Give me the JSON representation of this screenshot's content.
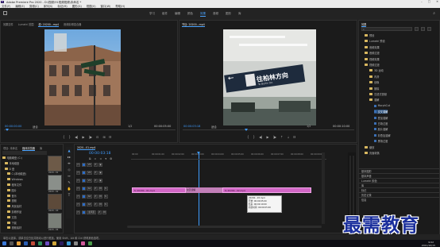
{
  "window": {
    "title": "Adobe Premiere Pro 2020 - D:\\视频\\91视频视频\\未命名 *",
    "controls": [
      "–",
      "□",
      "✕"
    ]
  },
  "menu": [
    "文件(F)",
    "编辑(E)",
    "剪辑(C)",
    "序列(S)",
    "标记(M)",
    "图形(G)",
    "视图(V)",
    "窗口(W)",
    "帮助(H)"
  ],
  "workspaces": {
    "tabs": [
      "学习",
      "组件",
      "编辑",
      "颜色",
      "效果",
      "音频",
      "图形",
      "库"
    ],
    "active": "效果"
  },
  "source_monitor": {
    "tabs": [
      "效果控件",
      "Lumetri 范围",
      "源: 20200...mp4",
      "音频剪辑混合器"
    ],
    "clip_label": "源: 20200...mp4",
    "timecode_left": "00:00:00:00",
    "fit": "适合",
    "ratio": "1/2",
    "timecode_right": "00:00:05:00",
    "marker": "■"
  },
  "program_monitor": {
    "tabs": [
      "节目: 20200...mp4"
    ],
    "clip_label": "节目: 20200...mp4",
    "timecode_left": "00:00:03:18",
    "fit": "适合",
    "ratio": "1/2",
    "timecode_right": "00:00:10:00",
    "sign": {
      "arrow": "←",
      "text": "往柏林方向",
      "sub": "To Berlin Str."
    }
  },
  "project_panel": {
    "tabs": [
      "项目: 未命名",
      "媒体浏览器",
      "库"
    ],
    "items": [
      {
        "label": "电脑硬盘 (C:)"
      },
      {
        "label": "本地磁盘"
      },
      {
        "label": "D 盘"
      },
      {
        "label": "C:(本地磁盘)"
      },
      {
        "label": "Windows"
      },
      {
        "label": "程序文件"
      },
      {
        "label": "图片"
      },
      {
        "label": "音乐"
      },
      {
        "label": "视频"
      },
      {
        "label": "风景素材"
      },
      {
        "label": "剪辑作品"
      },
      {
        "label": "文档"
      },
      {
        "label": "下载"
      },
      {
        "label": "视频素材"
      }
    ],
    "thumbs": [
      {
        "label": "2020...01"
      },
      {
        "label": "2020...02"
      },
      {
        "label": "2020...03"
      },
      {
        "label": "2020...04"
      }
    ]
  },
  "timeline": {
    "tab": "2020...01.mp4",
    "timecode": "00:00:03:18",
    "ruler_labels": [
      "00:00",
      "00:00:01:00",
      "00:00:02:00",
      "00:00:03:00",
      "00:00:04:00",
      "00:00:05:00",
      "00:00:06:00",
      "00:00:07:00",
      "00:00:08:00",
      "00:00:09:00"
    ],
    "tracks": [
      "V3",
      "V2",
      "V1",
      "A1",
      "A2",
      "A3",
      "主声道"
    ],
    "clips": [
      {
        "label": "fx  20200...01.mp4"
      },
      {
        "label": "fx  20200...02.mp4"
      }
    ],
    "transition_label": "交叉溶解",
    "tooltip": [
      "20200...03.mp4",
      "开始: 00:00:05:00",
      "结束: 00:00:10:00",
      "持续时间: 00:00:05:00"
    ],
    "master_label": "主声道"
  },
  "effects_panel": {
    "tabs": [
      "效果"
    ],
    "tree": [
      {
        "label": "预设",
        "kind": "folder"
      },
      {
        "label": "Lumetri 预设",
        "kind": "folder"
      },
      {
        "label": "音频效果",
        "kind": "folder"
      },
      {
        "label": "音频过渡",
        "kind": "folder"
      },
      {
        "label": "视频效果",
        "kind": "folder"
      },
      {
        "label": "视频过渡",
        "kind": "folder"
      },
      {
        "label": "3D 运动",
        "kind": "folder"
      },
      {
        "label": "内滑",
        "kind": "folder"
      },
      {
        "label": "划像",
        "kind": "folder"
      },
      {
        "label": "擦除",
        "kind": "folder"
      },
      {
        "label": "沉浸式视频",
        "kind": "folder"
      },
      {
        "label": "溶解",
        "kind": "folder"
      },
      {
        "label": "MorphCut",
        "kind": "fx"
      },
      {
        "label": "交叉溶解",
        "kind": "fx"
      },
      {
        "label": "叠加溶解",
        "kind": "fx"
      },
      {
        "label": "白场过渡",
        "kind": "fx"
      },
      {
        "label": "胶片溶解",
        "kind": "fx"
      },
      {
        "label": "非叠加溶解",
        "kind": "fx"
      },
      {
        "label": "黑场过渡",
        "kind": "fx"
      },
      {
        "label": "缩放",
        "kind": "folder"
      },
      {
        "label": "页面剥落",
        "kind": "folder"
      }
    ],
    "sections": [
      "基本图形",
      "基本声音",
      "Lumetri 颜色",
      "库",
      "标记",
      "历史记录",
      "信息"
    ]
  },
  "statusbar": {
    "text": "单击以选择，或单击空白处并拖动以进行框选。使用 Shift、Alt 和 Ctrl 获得其他选项。"
  },
  "taskbar": {
    "time": "9:02",
    "date": "2021/10/15"
  },
  "watermark": {
    "text": "最需教育"
  },
  "colors": {
    "accent_blue": "#3f9cff",
    "clip_pink": "#d267c6",
    "panel_bg": "#1b1b1b",
    "watermark_blue": "#1a2e9c"
  }
}
